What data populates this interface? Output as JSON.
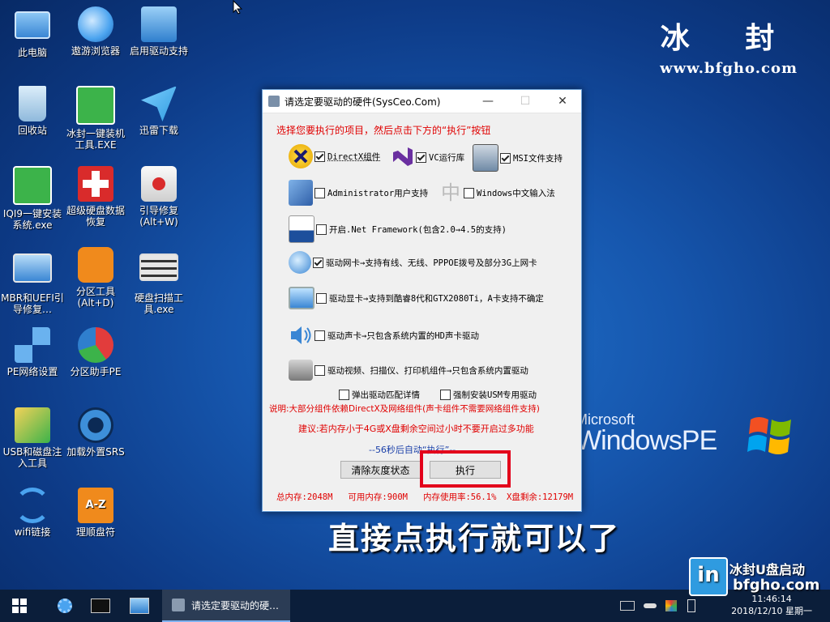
{
  "desktop_icons": [
    {
      "label": "此电脑",
      "icon": "computer-icon",
      "color": "#5fa8e8"
    },
    {
      "label": "遨游浏览器",
      "icon": "browser-icon",
      "color": "#4aa3ef"
    },
    {
      "label": "启用驱动支持",
      "icon": "network-monitor-icon",
      "color": "#3d8fd9"
    },
    {
      "label": "回收站",
      "icon": "recycle-bin-icon",
      "color": "#9fc7e6"
    },
    {
      "label": "冰封一键装机工具.EXE",
      "icon": "ghost-icon",
      "color": "#3cb34a"
    },
    {
      "label": "迅雷下载",
      "icon": "thunder-icon",
      "color": "#2f9be0"
    },
    {
      "label": "IQI9一键安装系统.exe",
      "icon": "ghost-green-icon",
      "color": "#3cb34a"
    },
    {
      "label": "超级硬盘数据恢复",
      "icon": "first-aid-icon",
      "color": "#d92b2b"
    },
    {
      "label": "引导修复(Alt+W)",
      "icon": "medkit-icon",
      "color": "#e8e8e8"
    },
    {
      "label": "MBR和UEFI引导修复…",
      "icon": "pc-repair-icon",
      "color": "#5fa8e8"
    },
    {
      "label": "分区工具(Alt+D)",
      "icon": "diskgenius-icon",
      "color": "#f08a1c"
    },
    {
      "label": "硬盘扫描工具.exe",
      "icon": "disk-scan-icon",
      "color": "#c9c9c9"
    },
    {
      "label": "PE网络设置",
      "icon": "network-settings-icon",
      "color": "#6ab2ef"
    },
    {
      "label": "分区助手PE",
      "icon": "partition-assistant-icon",
      "color": "#e23c3c"
    },
    {
      "label": "USB和磁盘注入工具",
      "icon": "usb-inject-icon",
      "color": "#e6b422"
    },
    {
      "label": "加载外置SRS",
      "icon": "srs-icon",
      "color": "#3d8fd9"
    },
    {
      "label": "wifi链接",
      "icon": "wifi-icon",
      "color": "#4aa3ef"
    },
    {
      "label": "理顺盘符",
      "icon": "az-sort-icon",
      "color": "#f08a1c"
    }
  ],
  "brand": {
    "title": "冰 封",
    "url": "www.bfgho.com"
  },
  "winpe": {
    "line1": "Microsoft",
    "line2": "WindowsPE"
  },
  "caption": "直接点执行就可以了",
  "dialog": {
    "title": "请选定要驱动的硬件(SysCeo.Com)",
    "minimize": "—",
    "maximize": "☐",
    "close": "✕",
    "instruction": "选择您要执行的项目，然后点击下方的“执行”按钮",
    "options": {
      "directx": {
        "label": "DirectX组件",
        "checked": true
      },
      "vc": {
        "label": "VC运行库",
        "checked": true
      },
      "msi": {
        "label": "MSI文件支持",
        "checked": true
      },
      "admin": {
        "label": "Administrator用户支持",
        "checked": false
      },
      "ime": {
        "label": "Windows中文输入法",
        "checked": false
      },
      "netfx": {
        "label": "开启.Net Framework(包含2.0→4.5的支持)",
        "checked": false
      },
      "nic": {
        "label": "驱动网卡→支持有线、无线、PPPOE拨号及部分3G上网卡",
        "checked": true
      },
      "gpu": {
        "label": "驱动显卡→支持到酷睿8代和GTX2080Ti，A卡支持不确定",
        "checked": false
      },
      "audio": {
        "label": "驱动声卡→只包含系统内置的HD声卡驱动",
        "checked": false
      },
      "video": {
        "label": "驱动视频、扫描仪、打印机组件→只包含系统内置驱动",
        "checked": false
      },
      "popup": {
        "label": "弹出驱动匹配详情",
        "checked": false
      },
      "usm": {
        "label": "强制安装USM专用驱动",
        "checked": false
      }
    },
    "note1": "说明:大部分组件依赖DirectX及网络组件(声卡组件不需要网络组件支持)",
    "note2": "建议:若内存小于4G或X盘剩余空间过小时不要开启过多功能",
    "countdown": "--56秒后自动“执行”--",
    "clear_button": "清除灰度状态",
    "exec_button": "执行",
    "status": "总内存:2048M   可用内存:900M   内存使用率:56.1%  X盘剩余:12179M"
  },
  "taskbar": {
    "task_label": "请选定要驱动的硬…",
    "time": "11:46:14",
    "date": "2018/12/10 星期一",
    "watermark_brand": "冰封U盘启动",
    "watermark_url": "bfgho.com"
  }
}
